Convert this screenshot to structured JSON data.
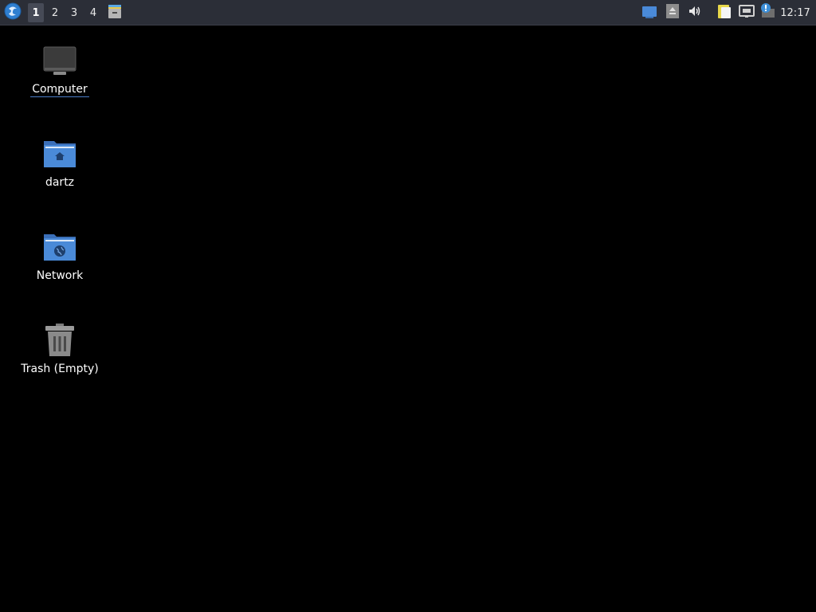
{
  "panel": {
    "start_menu_icon": "distro-logo-icon",
    "workspaces": [
      {
        "label": "1",
        "active": true
      },
      {
        "label": "2",
        "active": false
      },
      {
        "label": "3",
        "active": false
      },
      {
        "label": "4",
        "active": false
      }
    ],
    "launcher_icon": "file-cabinet-icon",
    "tray_icons": [
      "show-desktop-icon",
      "eject-icon",
      "volume-icon",
      "clipboard-icon",
      "network-wired-icon",
      "notification-icon"
    ],
    "clock": "12:17"
  },
  "desktop": {
    "icons": [
      {
        "label": "Computer",
        "icon": "computer-icon"
      },
      {
        "label": "dartz",
        "icon": "home-folder-icon"
      },
      {
        "label": "Network",
        "icon": "network-folder-icon"
      },
      {
        "label": "Trash (Empty)",
        "icon": "trash-icon"
      }
    ]
  },
  "colors": {
    "panel_bg": "#2b2e37",
    "desktop_bg": "#000000",
    "folder_blue": "#4a8ad8",
    "accent": "#3d8fd9"
  }
}
